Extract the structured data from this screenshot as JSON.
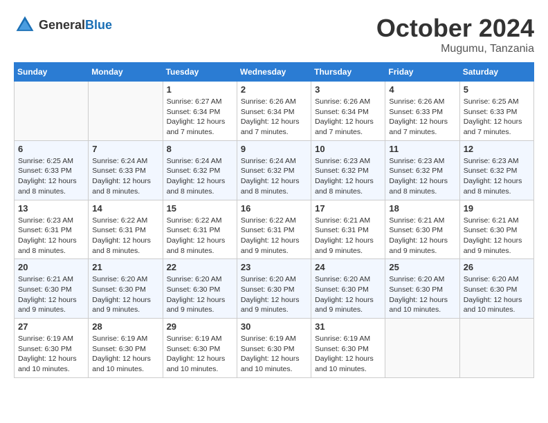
{
  "header": {
    "logo": {
      "general": "General",
      "blue": "Blue"
    },
    "month": "October 2024",
    "location": "Mugumu, Tanzania"
  },
  "weekdays": [
    "Sunday",
    "Monday",
    "Tuesday",
    "Wednesday",
    "Thursday",
    "Friday",
    "Saturday"
  ],
  "weeks": [
    [
      {
        "day": "",
        "detail": ""
      },
      {
        "day": "",
        "detail": ""
      },
      {
        "day": "1",
        "detail": "Sunrise: 6:27 AM\nSunset: 6:34 PM\nDaylight: 12 hours and 7 minutes."
      },
      {
        "day": "2",
        "detail": "Sunrise: 6:26 AM\nSunset: 6:34 PM\nDaylight: 12 hours and 7 minutes."
      },
      {
        "day": "3",
        "detail": "Sunrise: 6:26 AM\nSunset: 6:34 PM\nDaylight: 12 hours and 7 minutes."
      },
      {
        "day": "4",
        "detail": "Sunrise: 6:26 AM\nSunset: 6:33 PM\nDaylight: 12 hours and 7 minutes."
      },
      {
        "day": "5",
        "detail": "Sunrise: 6:25 AM\nSunset: 6:33 PM\nDaylight: 12 hours and 7 minutes."
      }
    ],
    [
      {
        "day": "6",
        "detail": "Sunrise: 6:25 AM\nSunset: 6:33 PM\nDaylight: 12 hours and 8 minutes."
      },
      {
        "day": "7",
        "detail": "Sunrise: 6:24 AM\nSunset: 6:33 PM\nDaylight: 12 hours and 8 minutes."
      },
      {
        "day": "8",
        "detail": "Sunrise: 6:24 AM\nSunset: 6:32 PM\nDaylight: 12 hours and 8 minutes."
      },
      {
        "day": "9",
        "detail": "Sunrise: 6:24 AM\nSunset: 6:32 PM\nDaylight: 12 hours and 8 minutes."
      },
      {
        "day": "10",
        "detail": "Sunrise: 6:23 AM\nSunset: 6:32 PM\nDaylight: 12 hours and 8 minutes."
      },
      {
        "day": "11",
        "detail": "Sunrise: 6:23 AM\nSunset: 6:32 PM\nDaylight: 12 hours and 8 minutes."
      },
      {
        "day": "12",
        "detail": "Sunrise: 6:23 AM\nSunset: 6:32 PM\nDaylight: 12 hours and 8 minutes."
      }
    ],
    [
      {
        "day": "13",
        "detail": "Sunrise: 6:23 AM\nSunset: 6:31 PM\nDaylight: 12 hours and 8 minutes."
      },
      {
        "day": "14",
        "detail": "Sunrise: 6:22 AM\nSunset: 6:31 PM\nDaylight: 12 hours and 8 minutes."
      },
      {
        "day": "15",
        "detail": "Sunrise: 6:22 AM\nSunset: 6:31 PM\nDaylight: 12 hours and 8 minutes."
      },
      {
        "day": "16",
        "detail": "Sunrise: 6:22 AM\nSunset: 6:31 PM\nDaylight: 12 hours and 9 minutes."
      },
      {
        "day": "17",
        "detail": "Sunrise: 6:21 AM\nSunset: 6:31 PM\nDaylight: 12 hours and 9 minutes."
      },
      {
        "day": "18",
        "detail": "Sunrise: 6:21 AM\nSunset: 6:30 PM\nDaylight: 12 hours and 9 minutes."
      },
      {
        "day": "19",
        "detail": "Sunrise: 6:21 AM\nSunset: 6:30 PM\nDaylight: 12 hours and 9 minutes."
      }
    ],
    [
      {
        "day": "20",
        "detail": "Sunrise: 6:21 AM\nSunset: 6:30 PM\nDaylight: 12 hours and 9 minutes."
      },
      {
        "day": "21",
        "detail": "Sunrise: 6:20 AM\nSunset: 6:30 PM\nDaylight: 12 hours and 9 minutes."
      },
      {
        "day": "22",
        "detail": "Sunrise: 6:20 AM\nSunset: 6:30 PM\nDaylight: 12 hours and 9 minutes."
      },
      {
        "day": "23",
        "detail": "Sunrise: 6:20 AM\nSunset: 6:30 PM\nDaylight: 12 hours and 9 minutes."
      },
      {
        "day": "24",
        "detail": "Sunrise: 6:20 AM\nSunset: 6:30 PM\nDaylight: 12 hours and 9 minutes."
      },
      {
        "day": "25",
        "detail": "Sunrise: 6:20 AM\nSunset: 6:30 PM\nDaylight: 12 hours and 10 minutes."
      },
      {
        "day": "26",
        "detail": "Sunrise: 6:20 AM\nSunset: 6:30 PM\nDaylight: 12 hours and 10 minutes."
      }
    ],
    [
      {
        "day": "27",
        "detail": "Sunrise: 6:19 AM\nSunset: 6:30 PM\nDaylight: 12 hours and 10 minutes."
      },
      {
        "day": "28",
        "detail": "Sunrise: 6:19 AM\nSunset: 6:30 PM\nDaylight: 12 hours and 10 minutes."
      },
      {
        "day": "29",
        "detail": "Sunrise: 6:19 AM\nSunset: 6:30 PM\nDaylight: 12 hours and 10 minutes."
      },
      {
        "day": "30",
        "detail": "Sunrise: 6:19 AM\nSunset: 6:30 PM\nDaylight: 12 hours and 10 minutes."
      },
      {
        "day": "31",
        "detail": "Sunrise: 6:19 AM\nSunset: 6:30 PM\nDaylight: 12 hours and 10 minutes."
      },
      {
        "day": "",
        "detail": ""
      },
      {
        "day": "",
        "detail": ""
      }
    ]
  ]
}
